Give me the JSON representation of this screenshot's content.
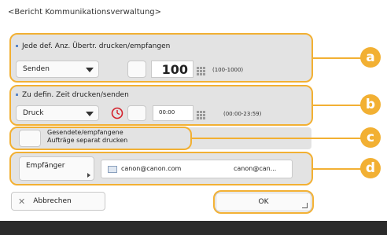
{
  "screen": {
    "title": "<Bericht Kommunikationsverwaltung>",
    "accent_color": "#f2b033",
    "footer_bar_color": "#2b2b2b"
  },
  "sections": {
    "a": {
      "label": "Jede def. Anz. Übertr. drucken/empfangen",
      "mode_value": "Senden",
      "count_value": "100",
      "range_text": "(100-1000)",
      "badge": "a"
    },
    "b": {
      "label": "Zu defin. Zeit drucken/senden",
      "mode_value": "Druck",
      "time_value": "00:00",
      "range_text": "(00:00-23:59)",
      "badge": "b"
    },
    "c": {
      "checkbox_label_line1": "Gesendete/empfangene",
      "checkbox_label_line2": "Aufträge separat drucken",
      "badge": "c"
    },
    "d": {
      "recipient_button": "Empfänger",
      "recipient_name": "canon@canon.com",
      "recipient_address": "canon@can...",
      "badge": "d"
    }
  },
  "footer": {
    "cancel_icon": "close-icon",
    "cancel_label": "Abbrechen",
    "ok_label": "OK"
  }
}
